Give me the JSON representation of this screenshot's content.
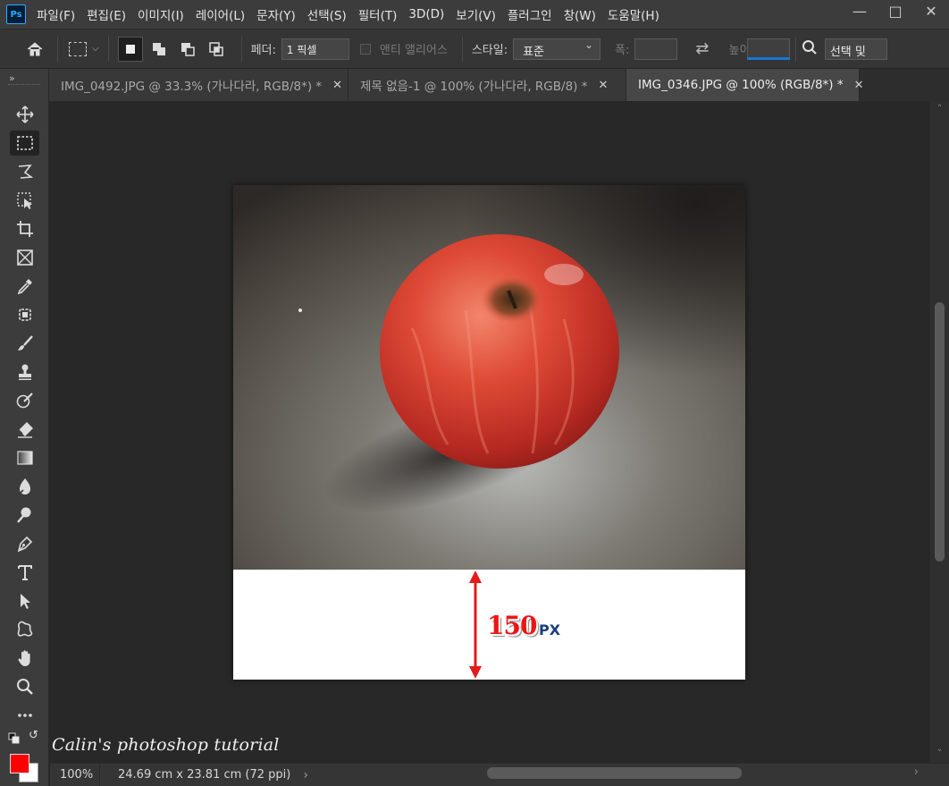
{
  "app": {
    "logo": "Ps",
    "menu": [
      "파일(F)",
      "편집(E)",
      "이미지(I)",
      "레이어(L)",
      "문자(Y)",
      "선택(S)",
      "필터(T)",
      "3D(D)",
      "보기(V)",
      "플러그인",
      "창(W)",
      "도움말(H)"
    ],
    "window_controls": [
      "minimize-icon",
      "maximize-icon",
      "close-icon"
    ]
  },
  "options": {
    "feather_label": "페더:",
    "feather_value": "1 픽셀",
    "antialias_label": "앤티 앨리어스",
    "style_label": "스타일:",
    "style_value": "표준",
    "width_label": "폭:",
    "height_label": "높이:",
    "select_mask_label": "선택 및"
  },
  "tabs": [
    {
      "label": "IMG_0492.JPG @ 33.3% (가나다라, RGB/8*) *",
      "active": false
    },
    {
      "label": "제목 없음-1 @ 100% (가나다라, RGB/8) *",
      "active": false
    },
    {
      "label": "IMG_0346.JPG @ 100% (RGB/8*) *",
      "active": true
    }
  ],
  "tools": [
    "move-icon",
    "rect-marquee-icon",
    "lasso-icon",
    "object-select-icon",
    "crop-icon",
    "frame-icon",
    "eyedropper-icon",
    "spot-heal-icon",
    "brush-icon",
    "clone-stamp-icon",
    "history-brush-icon",
    "eraser-icon",
    "gradient-icon",
    "blur-icon",
    "dodge-icon",
    "pen-icon",
    "type-icon",
    "path-select-icon",
    "shape-icon",
    "hand-icon",
    "zoom-icon",
    "more-icon"
  ],
  "colors": {
    "foreground": "#ff0000",
    "background": "#ffffff"
  },
  "annotation": {
    "value": "150",
    "unit": "PX"
  },
  "status": {
    "zoom": "100%",
    "doc_size": "24.69 cm x 23.81 cm (72 ppi)"
  },
  "watermark": "Calin's photoshop tutorial"
}
